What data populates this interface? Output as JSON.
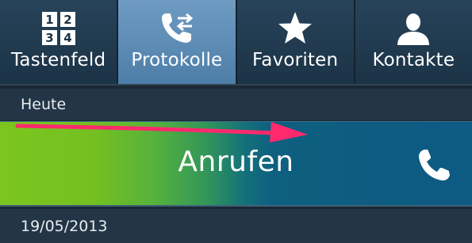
{
  "tabs": [
    {
      "label": "Tastenfeld",
      "icon": "keypad-icon",
      "active": false
    },
    {
      "label": "Protokolle",
      "icon": "call-log-icon",
      "active": true
    },
    {
      "label": "Favoriten",
      "icon": "star-icon",
      "active": false
    },
    {
      "label": "Kontakte",
      "icon": "contact-icon",
      "active": false
    }
  ],
  "keypad_digits": [
    "1",
    "2",
    "3",
    "4"
  ],
  "sections": {
    "today": "Heute",
    "date": "19/05/2013"
  },
  "swipe_row": {
    "label": "Anrufen",
    "icon": "phone-icon"
  },
  "colors": {
    "active_tab": "#5a8ab4",
    "swipe_start": "#7cc520",
    "swipe_end": "#0d5a82",
    "arrow": "#ff2a6d"
  }
}
